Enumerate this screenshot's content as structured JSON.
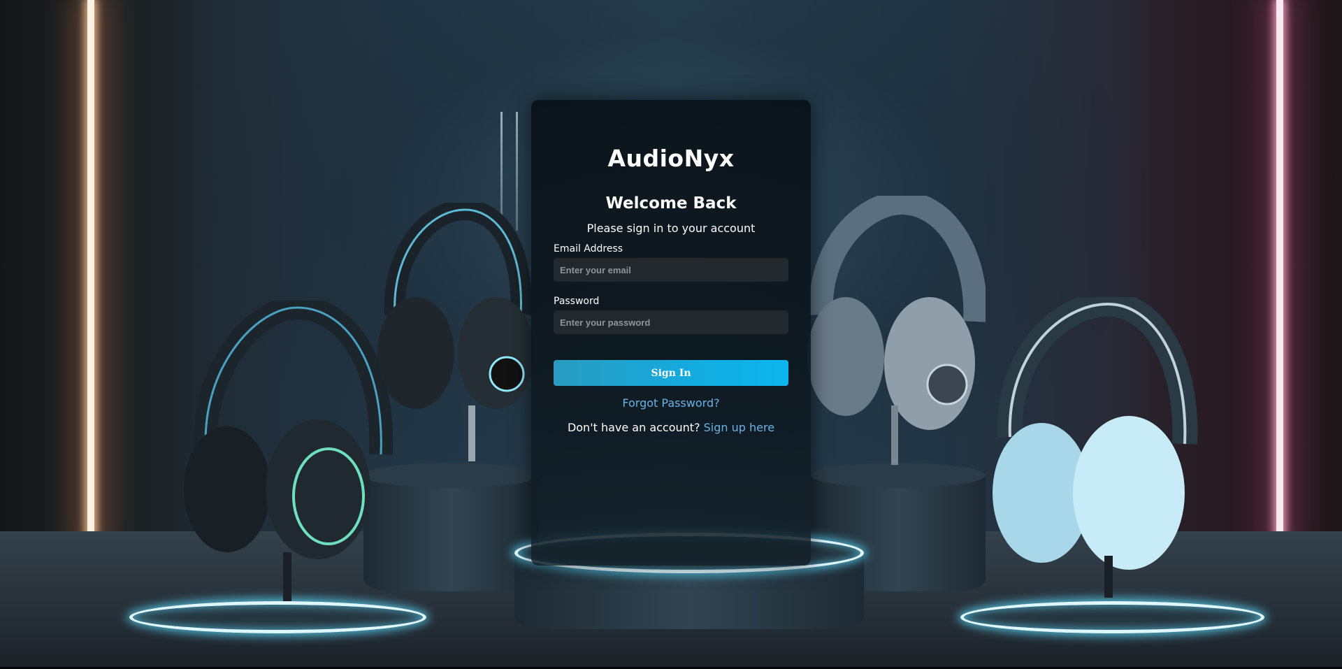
{
  "brand": {
    "logo_text": "AudioNyx"
  },
  "login": {
    "title": "Welcome Back",
    "subtitle": "Please sign in to your account",
    "email": {
      "label": "Email Address",
      "placeholder": "Enter your email",
      "value": ""
    },
    "password": {
      "label": "Password",
      "placeholder": "Enter your password",
      "value": ""
    },
    "signin_label": "Sign In",
    "forgot_label": "Forgot Password?",
    "signup_prompt": "Don't have an account?",
    "signup_link_label": "Sign up here"
  },
  "colors": {
    "accent": "#14aadd",
    "link": "#6ab2e6",
    "card_bg": "#0c161e",
    "input_bg": "#23282d"
  },
  "background": {
    "description_icons": [
      "headset-image",
      "neon-light-strip",
      "glowing-pedestal"
    ]
  }
}
